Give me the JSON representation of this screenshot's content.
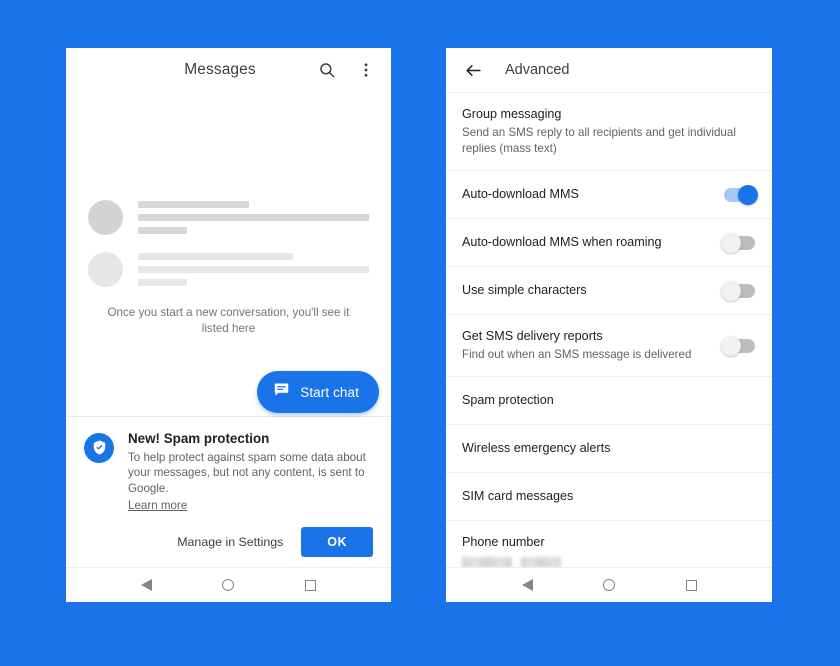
{
  "theme": {
    "background": "#1a73e8",
    "accent": "#1a73e8",
    "panel": "#ffffff",
    "text_primary": "#202124",
    "text_secondary": "#5f6368",
    "divider": "#eceff1"
  },
  "left_phone": {
    "appbar": {
      "title": "Messages",
      "search_icon": "search-icon",
      "overflow_icon": "more-vert-icon"
    },
    "conversation_placeholders": [
      {
        "tone": "dark"
      },
      {
        "tone": "light"
      }
    ],
    "empty_state": {
      "text": "Once you start a new conversation, you'll see it listed here"
    },
    "fab": {
      "label": "Start chat",
      "icon": "chat-bubble-icon"
    },
    "banner": {
      "icon": "shield-check-icon",
      "title": "New! Spam protection",
      "body": "To help protect against spam some data about your messages, but not any content, is sent to Google.",
      "link": "Learn more",
      "secondary_action": "Manage in Settings",
      "primary_action": "OK"
    },
    "navbar": {
      "back": "back-triangle-icon",
      "home": "home-circle-icon",
      "recents": "recents-square-icon"
    }
  },
  "right_phone": {
    "appbar": {
      "back_icon": "arrow-back-icon",
      "title": "Advanced"
    },
    "settings": [
      {
        "title": "Group messaging",
        "subtitle": "Send an SMS reply to all recipients and get individual replies (mass text)",
        "control": "none"
      },
      {
        "title": "Auto-download MMS",
        "subtitle": "",
        "control": "toggle",
        "toggle_state": "on"
      },
      {
        "title": "Auto-download MMS when roaming",
        "subtitle": "",
        "control": "toggle",
        "toggle_state": "off"
      },
      {
        "title": "Use simple characters",
        "subtitle": "",
        "control": "toggle",
        "toggle_state": "off"
      },
      {
        "title": "Get SMS delivery reports",
        "subtitle": "Find out when an SMS message is delivered",
        "control": "toggle",
        "toggle_state": "off"
      },
      {
        "title": "Spam protection",
        "subtitle": "",
        "control": "none"
      },
      {
        "title": "Wireless emergency alerts",
        "subtitle": "",
        "control": "none"
      },
      {
        "title": "SIM card messages",
        "subtitle": "",
        "control": "none"
      },
      {
        "title": "Phone number",
        "subtitle": "",
        "control": "redacted"
      }
    ],
    "navbar": {
      "back": "back-triangle-icon",
      "home": "home-circle-icon",
      "recents": "recents-square-icon"
    }
  }
}
